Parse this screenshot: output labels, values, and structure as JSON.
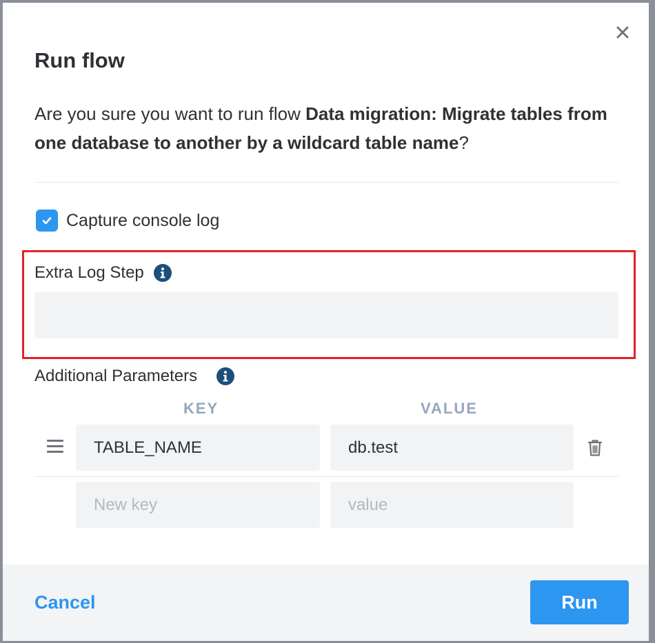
{
  "dialog": {
    "title": "Run flow",
    "question_prefix": "Are you sure you want to run flow ",
    "flow_name": "Data migration: Migrate tables from one database to another by a wildcard table name",
    "question_suffix": "?"
  },
  "capture": {
    "label": "Capture console log",
    "checked": true
  },
  "extra_log_step": {
    "label": "Extra Log Step",
    "value": ""
  },
  "additional_parameters": {
    "label": "Additional Parameters",
    "key_header": "KEY",
    "value_header": "VALUE",
    "rows": [
      {
        "key": "TABLE_NAME",
        "value": "db.test"
      }
    ],
    "new_row": {
      "key_placeholder": "New key",
      "value_placeholder": "value"
    }
  },
  "footer": {
    "cancel_label": "Cancel",
    "run_label": "Run"
  },
  "colors": {
    "accent": "#2d96f0",
    "highlight": "#e3202a",
    "info_icon": "#1c4f7c"
  }
}
